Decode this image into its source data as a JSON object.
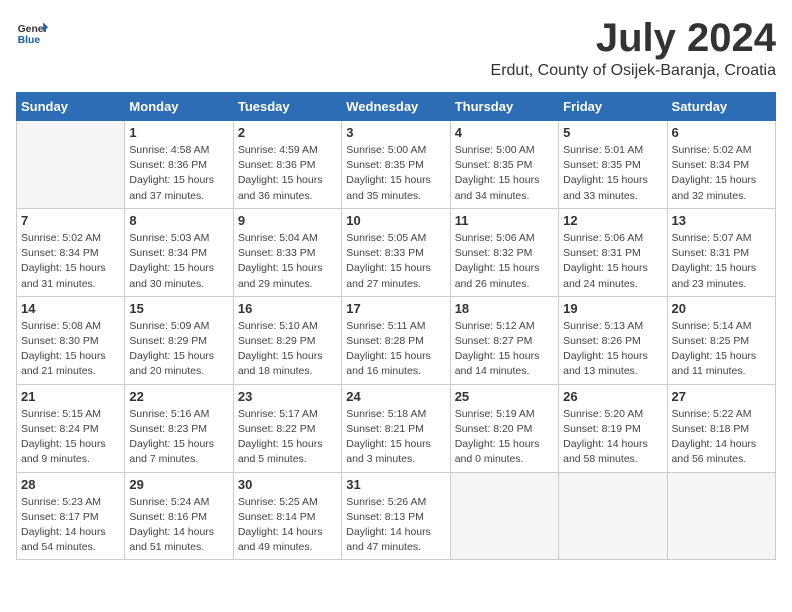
{
  "logo": {
    "general": "General",
    "blue": "Blue"
  },
  "title": "July 2024",
  "location": "Erdut, County of Osijek-Baranja, Croatia",
  "days_of_week": [
    "Sunday",
    "Monday",
    "Tuesday",
    "Wednesday",
    "Thursday",
    "Friday",
    "Saturday"
  ],
  "weeks": [
    [
      {
        "num": "",
        "sunrise": "",
        "sunset": "",
        "daylight": ""
      },
      {
        "num": "1",
        "sunrise": "Sunrise: 4:58 AM",
        "sunset": "Sunset: 8:36 PM",
        "daylight": "Daylight: 15 hours and 37 minutes."
      },
      {
        "num": "2",
        "sunrise": "Sunrise: 4:59 AM",
        "sunset": "Sunset: 8:36 PM",
        "daylight": "Daylight: 15 hours and 36 minutes."
      },
      {
        "num": "3",
        "sunrise": "Sunrise: 5:00 AM",
        "sunset": "Sunset: 8:35 PM",
        "daylight": "Daylight: 15 hours and 35 minutes."
      },
      {
        "num": "4",
        "sunrise": "Sunrise: 5:00 AM",
        "sunset": "Sunset: 8:35 PM",
        "daylight": "Daylight: 15 hours and 34 minutes."
      },
      {
        "num": "5",
        "sunrise": "Sunrise: 5:01 AM",
        "sunset": "Sunset: 8:35 PM",
        "daylight": "Daylight: 15 hours and 33 minutes."
      },
      {
        "num": "6",
        "sunrise": "Sunrise: 5:02 AM",
        "sunset": "Sunset: 8:34 PM",
        "daylight": "Daylight: 15 hours and 32 minutes."
      }
    ],
    [
      {
        "num": "7",
        "sunrise": "Sunrise: 5:02 AM",
        "sunset": "Sunset: 8:34 PM",
        "daylight": "Daylight: 15 hours and 31 minutes."
      },
      {
        "num": "8",
        "sunrise": "Sunrise: 5:03 AM",
        "sunset": "Sunset: 8:34 PM",
        "daylight": "Daylight: 15 hours and 30 minutes."
      },
      {
        "num": "9",
        "sunrise": "Sunrise: 5:04 AM",
        "sunset": "Sunset: 8:33 PM",
        "daylight": "Daylight: 15 hours and 29 minutes."
      },
      {
        "num": "10",
        "sunrise": "Sunrise: 5:05 AM",
        "sunset": "Sunset: 8:33 PM",
        "daylight": "Daylight: 15 hours and 27 minutes."
      },
      {
        "num": "11",
        "sunrise": "Sunrise: 5:06 AM",
        "sunset": "Sunset: 8:32 PM",
        "daylight": "Daylight: 15 hours and 26 minutes."
      },
      {
        "num": "12",
        "sunrise": "Sunrise: 5:06 AM",
        "sunset": "Sunset: 8:31 PM",
        "daylight": "Daylight: 15 hours and 24 minutes."
      },
      {
        "num": "13",
        "sunrise": "Sunrise: 5:07 AM",
        "sunset": "Sunset: 8:31 PM",
        "daylight": "Daylight: 15 hours and 23 minutes."
      }
    ],
    [
      {
        "num": "14",
        "sunrise": "Sunrise: 5:08 AM",
        "sunset": "Sunset: 8:30 PM",
        "daylight": "Daylight: 15 hours and 21 minutes."
      },
      {
        "num": "15",
        "sunrise": "Sunrise: 5:09 AM",
        "sunset": "Sunset: 8:29 PM",
        "daylight": "Daylight: 15 hours and 20 minutes."
      },
      {
        "num": "16",
        "sunrise": "Sunrise: 5:10 AM",
        "sunset": "Sunset: 8:29 PM",
        "daylight": "Daylight: 15 hours and 18 minutes."
      },
      {
        "num": "17",
        "sunrise": "Sunrise: 5:11 AM",
        "sunset": "Sunset: 8:28 PM",
        "daylight": "Daylight: 15 hours and 16 minutes."
      },
      {
        "num": "18",
        "sunrise": "Sunrise: 5:12 AM",
        "sunset": "Sunset: 8:27 PM",
        "daylight": "Daylight: 15 hours and 14 minutes."
      },
      {
        "num": "19",
        "sunrise": "Sunrise: 5:13 AM",
        "sunset": "Sunset: 8:26 PM",
        "daylight": "Daylight: 15 hours and 13 minutes."
      },
      {
        "num": "20",
        "sunrise": "Sunrise: 5:14 AM",
        "sunset": "Sunset: 8:25 PM",
        "daylight": "Daylight: 15 hours and 11 minutes."
      }
    ],
    [
      {
        "num": "21",
        "sunrise": "Sunrise: 5:15 AM",
        "sunset": "Sunset: 8:24 PM",
        "daylight": "Daylight: 15 hours and 9 minutes."
      },
      {
        "num": "22",
        "sunrise": "Sunrise: 5:16 AM",
        "sunset": "Sunset: 8:23 PM",
        "daylight": "Daylight: 15 hours and 7 minutes."
      },
      {
        "num": "23",
        "sunrise": "Sunrise: 5:17 AM",
        "sunset": "Sunset: 8:22 PM",
        "daylight": "Daylight: 15 hours and 5 minutes."
      },
      {
        "num": "24",
        "sunrise": "Sunrise: 5:18 AM",
        "sunset": "Sunset: 8:21 PM",
        "daylight": "Daylight: 15 hours and 3 minutes."
      },
      {
        "num": "25",
        "sunrise": "Sunrise: 5:19 AM",
        "sunset": "Sunset: 8:20 PM",
        "daylight": "Daylight: 15 hours and 0 minutes."
      },
      {
        "num": "26",
        "sunrise": "Sunrise: 5:20 AM",
        "sunset": "Sunset: 8:19 PM",
        "daylight": "Daylight: 14 hours and 58 minutes."
      },
      {
        "num": "27",
        "sunrise": "Sunrise: 5:22 AM",
        "sunset": "Sunset: 8:18 PM",
        "daylight": "Daylight: 14 hours and 56 minutes."
      }
    ],
    [
      {
        "num": "28",
        "sunrise": "Sunrise: 5:23 AM",
        "sunset": "Sunset: 8:17 PM",
        "daylight": "Daylight: 14 hours and 54 minutes."
      },
      {
        "num": "29",
        "sunrise": "Sunrise: 5:24 AM",
        "sunset": "Sunset: 8:16 PM",
        "daylight": "Daylight: 14 hours and 51 minutes."
      },
      {
        "num": "30",
        "sunrise": "Sunrise: 5:25 AM",
        "sunset": "Sunset: 8:14 PM",
        "daylight": "Daylight: 14 hours and 49 minutes."
      },
      {
        "num": "31",
        "sunrise": "Sunrise: 5:26 AM",
        "sunset": "Sunset: 8:13 PM",
        "daylight": "Daylight: 14 hours and 47 minutes."
      },
      {
        "num": "",
        "sunrise": "",
        "sunset": "",
        "daylight": ""
      },
      {
        "num": "",
        "sunrise": "",
        "sunset": "",
        "daylight": ""
      },
      {
        "num": "",
        "sunrise": "",
        "sunset": "",
        "daylight": ""
      }
    ]
  ]
}
